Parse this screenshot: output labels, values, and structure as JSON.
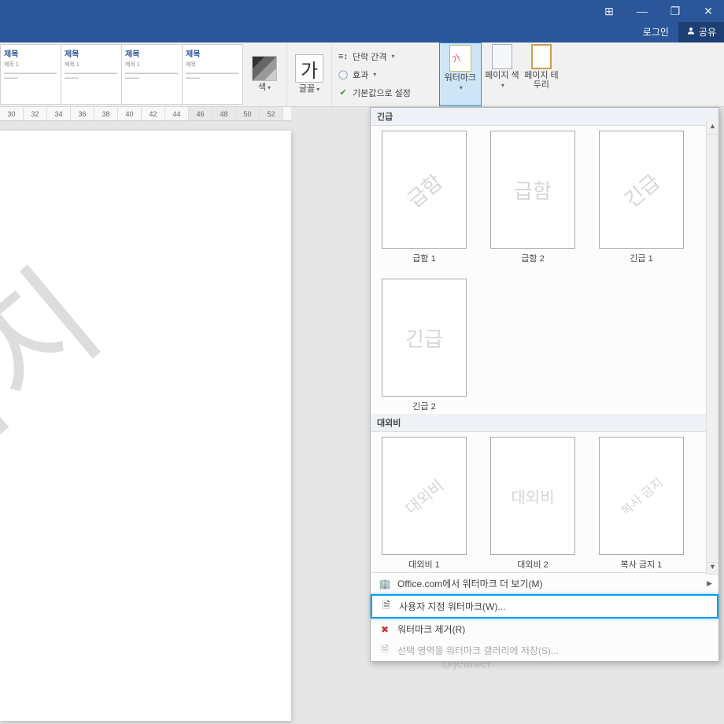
{
  "title_bar": {
    "ribbon_opts_icon": "⊞",
    "minimize_icon": "—",
    "restore_icon": "❐",
    "close_icon": "✕"
  },
  "account": {
    "login_label": "로그인",
    "share_label": "공유"
  },
  "ribbon": {
    "styles": [
      {
        "title": "제목",
        "sub": "제목 1"
      },
      {
        "title": "제목",
        "sub": "제목 1"
      },
      {
        "title": "제목",
        "sub": "제목 1"
      },
      {
        "title": "제목",
        "sub": "제목"
      }
    ],
    "color_label": "색",
    "font_label": "글꼴",
    "font_glyph": "가",
    "para_spacing_label": "단락 간격",
    "effects_label": "효과",
    "set_default_label": "기본값으로 설정",
    "watermark_label": "워터마크",
    "page_color_label": "페이지 색",
    "page_border_label": "페이지 테두리"
  },
  "ruler": {
    "ticks": [
      "30",
      "32",
      "34",
      "36",
      "38",
      "40",
      "42",
      "44",
      "46",
      "48",
      "50",
      "52"
    ]
  },
  "doc": {
    "watermark_text": "금지"
  },
  "wm_panel": {
    "section1": "긴급",
    "section2": "대외비",
    "items1": [
      {
        "text": "급함",
        "cap": "급함 1",
        "diag": true
      },
      {
        "text": "급함",
        "cap": "급함 2",
        "diag": false
      },
      {
        "text": "긴급",
        "cap": "긴급 1",
        "diag": true
      },
      {
        "text": "긴급",
        "cap": "긴급 2",
        "diag": false
      }
    ],
    "items2": [
      {
        "text": "대외비",
        "cap": "대외비 1",
        "diag": true
      },
      {
        "text": "대외비",
        "cap": "대외비 2",
        "diag": false
      },
      {
        "text": "복사 금지",
        "cap": "복사 금지 1",
        "diag": true
      }
    ],
    "menu": {
      "more_office": "Office.com에서 워터마크 더 보기(M)",
      "custom": "사용자 지정 워터마크(W)...",
      "remove": "워터마크 제거(R)",
      "save_sel": "선택 영역을 워터마크 갤러리에 저장(S)..."
    }
  },
  "credit": "@jeaniel"
}
